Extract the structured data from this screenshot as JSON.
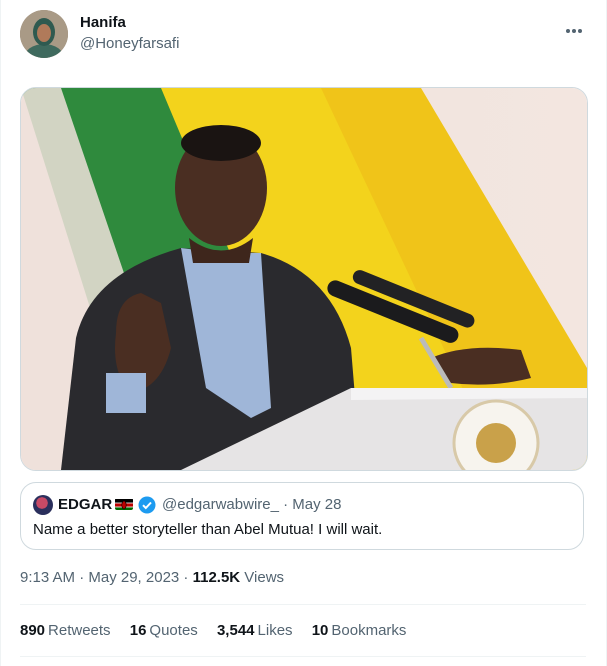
{
  "author": {
    "name": "Hanifa",
    "handle": "@Honeyfarsafi"
  },
  "quoted": {
    "name": "EDGAR",
    "handle": "@edgarwabwire_",
    "date": "· May 28",
    "text": "Name a better storyteller than Abel Mutua! I will wait."
  },
  "meta": {
    "time": "9:13 AM · May 29, 2023 · ",
    "views_count": "112.5K",
    "views_label": " Views"
  },
  "stats": [
    {
      "count": "890",
      "label": "Retweets"
    },
    {
      "count": "16",
      "label": "Quotes"
    },
    {
      "count": "3,544",
      "label": "Likes"
    },
    {
      "count": "10",
      "label": "Bookmarks"
    }
  ],
  "icons": {
    "more": "more-horizontal-icon",
    "verified": "verified-badge-icon",
    "flag": "kenya-flag-icon"
  },
  "colors": {
    "text": "#0f1419",
    "secondary": "#536471",
    "verified": "#1d9bf0",
    "border": "#cfd9de"
  }
}
